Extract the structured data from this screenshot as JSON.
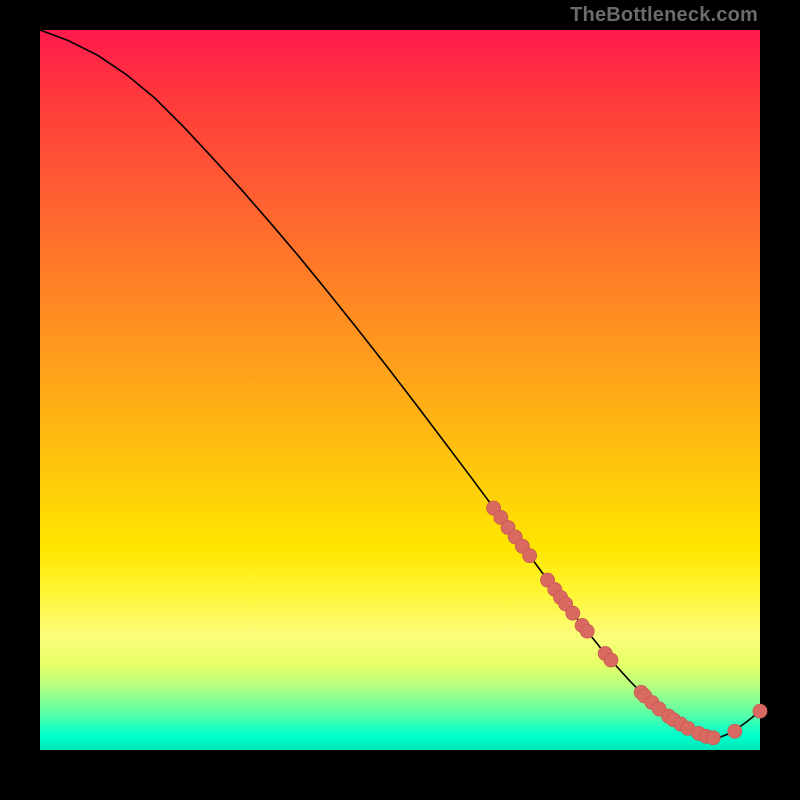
{
  "watermark": "TheBottleneck.com",
  "colors": {
    "background": "#000000",
    "curve": "#000000",
    "marker_fill": "#d86a62",
    "marker_stroke": "#c95a52"
  },
  "chart_data": {
    "type": "line",
    "title": "",
    "xlabel": "",
    "ylabel": "",
    "xlim": [
      0,
      100
    ],
    "ylim": [
      0,
      100
    ],
    "grid": false,
    "legend": null,
    "series": [
      {
        "name": "curve",
        "x": [
          0,
          4,
          8,
          12,
          16,
          20,
          24,
          28,
          32,
          36,
          40,
          44,
          48,
          52,
          56,
          60,
          64,
          68,
          72,
          74,
          76,
          78,
          80,
          82,
          84,
          86,
          88,
          90,
          92,
          94,
          96,
          98,
          100
        ],
        "y": [
          100,
          98.5,
          96.5,
          93.8,
          90.5,
          86.5,
          82.2,
          77.8,
          73.2,
          68.5,
          63.6,
          58.6,
          53.5,
          48.3,
          43.0,
          37.7,
          32.3,
          27.0,
          21.6,
          19.0,
          16.5,
          14.0,
          11.7,
          9.5,
          7.5,
          5.7,
          4.2,
          3.0,
          2.1,
          1.6,
          2.4,
          3.8,
          5.4
        ]
      }
    ],
    "scatter_points": [
      {
        "x": 63.0,
        "y": 33.6
      },
      {
        "x": 64.0,
        "y": 32.3
      },
      {
        "x": 65.0,
        "y": 30.9
      },
      {
        "x": 66.0,
        "y": 29.6
      },
      {
        "x": 67.0,
        "y": 28.3
      },
      {
        "x": 68.0,
        "y": 27.0
      },
      {
        "x": 70.5,
        "y": 23.6
      },
      {
        "x": 71.5,
        "y": 22.3
      },
      {
        "x": 72.3,
        "y": 21.2
      },
      {
        "x": 73.0,
        "y": 20.3
      },
      {
        "x": 74.0,
        "y": 19.0
      },
      {
        "x": 75.3,
        "y": 17.3
      },
      {
        "x": 76.0,
        "y": 16.5
      },
      {
        "x": 78.5,
        "y": 13.4
      },
      {
        "x": 79.3,
        "y": 12.5
      },
      {
        "x": 83.5,
        "y": 8.0
      },
      {
        "x": 84.0,
        "y": 7.5
      },
      {
        "x": 85.0,
        "y": 6.6
      },
      {
        "x": 86.0,
        "y": 5.7
      },
      {
        "x": 87.3,
        "y": 4.7
      },
      {
        "x": 88.0,
        "y": 4.2
      },
      {
        "x": 89.0,
        "y": 3.6
      },
      {
        "x": 90.0,
        "y": 3.0
      },
      {
        "x": 91.5,
        "y": 2.3
      },
      {
        "x": 92.5,
        "y": 1.9
      },
      {
        "x": 93.5,
        "y": 1.7
      },
      {
        "x": 96.5,
        "y": 2.6
      },
      {
        "x": 100.0,
        "y": 5.4
      }
    ]
  }
}
